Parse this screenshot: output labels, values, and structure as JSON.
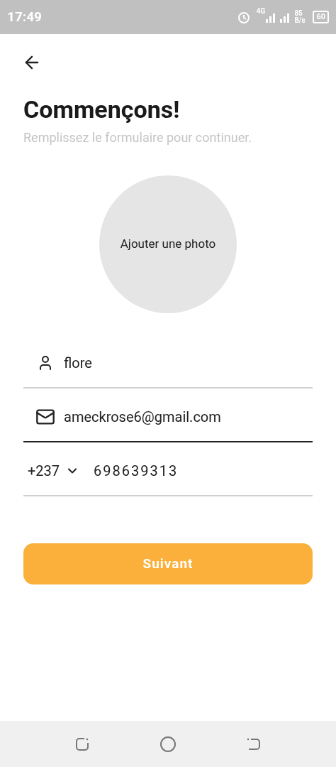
{
  "status_bar": {
    "time": "17:49",
    "network": "4G",
    "speed": "85 B/s",
    "battery": "60"
  },
  "title": "Commençons!",
  "subtitle": "Remplissez le formulaire pour continuer.",
  "photo": {
    "label": "Ajouter une photo"
  },
  "fields": [
    {
      "kind": "name",
      "value": "flore",
      "focused": false
    },
    {
      "kind": "email",
      "value": "ameckrose6@gmail.com",
      "focused": true
    },
    {
      "kind": "phone",
      "code": "+237",
      "value": "698639313",
      "focused": false
    }
  ],
  "button": "Suivant"
}
